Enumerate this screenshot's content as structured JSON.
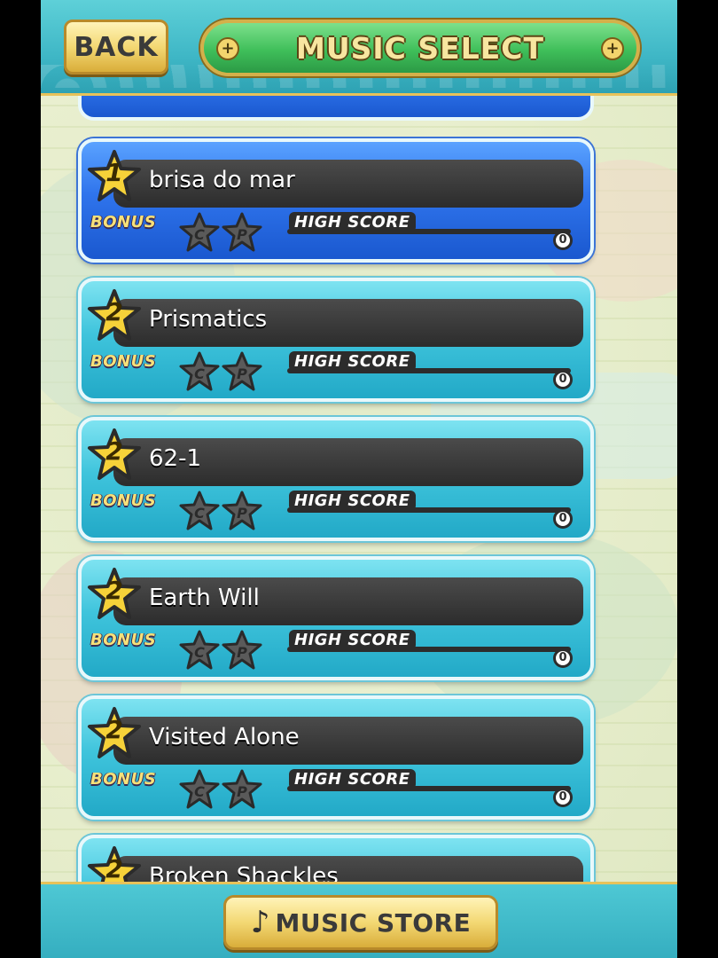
{
  "header": {
    "back_label": "BACK",
    "title": "MUSIC SELECT"
  },
  "songs": [
    {
      "title": "brisa do mar",
      "difficulty": "1",
      "selected": true,
      "bonus_label": "BONUS",
      "high_score_label": "HIGH SCORE",
      "high_score": "0"
    },
    {
      "title": "Prismatics",
      "difficulty": "2",
      "selected": false,
      "bonus_label": "BONUS",
      "high_score_label": "HIGH SCORE",
      "high_score": "0"
    },
    {
      "title": "62-1",
      "difficulty": "2",
      "selected": false,
      "bonus_label": "BONUS",
      "high_score_label": "HIGH SCORE",
      "high_score": "0"
    },
    {
      "title": "Earth Will",
      "difficulty": "2",
      "selected": false,
      "bonus_label": "BONUS",
      "high_score_label": "HIGH SCORE",
      "high_score": "0"
    },
    {
      "title": "Visited Alone",
      "difficulty": "2",
      "selected": false,
      "bonus_label": "BONUS",
      "high_score_label": "HIGH SCORE",
      "high_score": "0"
    },
    {
      "title": "Broken Shackles",
      "difficulty": "2",
      "selected": false
    }
  ],
  "footer": {
    "music_store_label": "MUSIC STORE",
    "note_icon": "music-note-icon"
  },
  "medals": [
    "C",
    "P"
  ],
  "colors": {
    "selected_card": "#2f74ec",
    "card": "#3fc4dc",
    "header": "#3fb7c6",
    "title_bar": "#3fbf5a",
    "gold": "#f3d873"
  }
}
